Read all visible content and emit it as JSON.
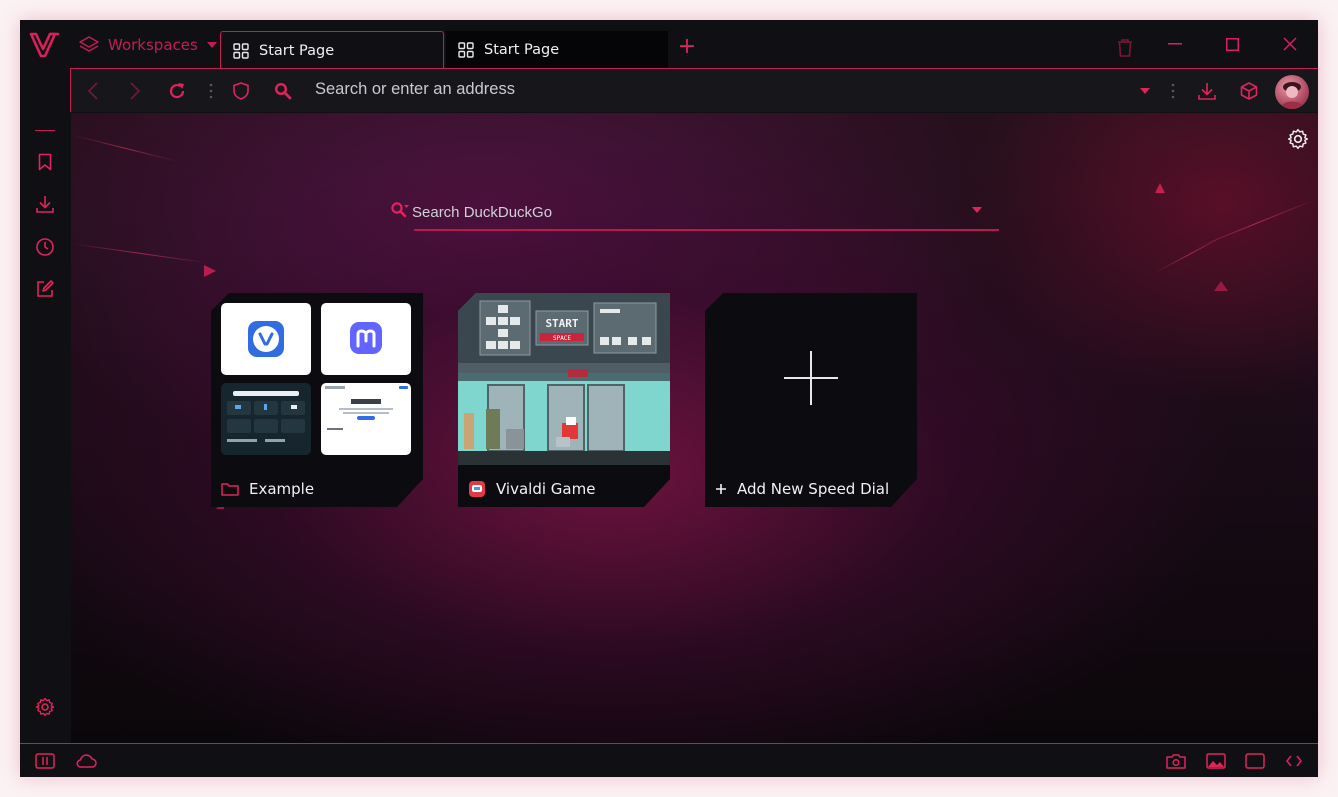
{
  "tabbar": {
    "workspaces_label": "Workspaces",
    "tabs": [
      {
        "title": "Start Page",
        "icon": "speed-dial-grid-icon",
        "active": true
      },
      {
        "title": "Start Page",
        "icon": "speed-dial-grid-icon",
        "active": false
      }
    ],
    "new_tab_label": "+"
  },
  "toolbar": {
    "address_placeholder": "Search or enter an address"
  },
  "start_page": {
    "search_placeholder": "Search DuckDuckGo",
    "speed_dials": [
      {
        "title": "Example",
        "type": "folder",
        "icon": "folder-icon"
      },
      {
        "title": "Vivaldi Game",
        "type": "site",
        "icon": "vivaldi-game-icon"
      },
      {
        "title": "Add New Speed Dial",
        "type": "add",
        "icon": "plus-icon"
      }
    ],
    "game_thumbnail": {
      "start_label": "START",
      "space_label": "SPACE"
    },
    "folder_thumbnail": {
      "mini_heading": "Hi, Fella",
      "items": [
        "vivaldi-logo",
        "mastodon-logo",
        "dark-page-preview",
        "light-page-preview"
      ]
    }
  },
  "colors": {
    "accent": "#c41e4e",
    "accent_bright": "#e0245a",
    "chrome_bg": "#101014",
    "toolbar_bg": "#16161b"
  }
}
